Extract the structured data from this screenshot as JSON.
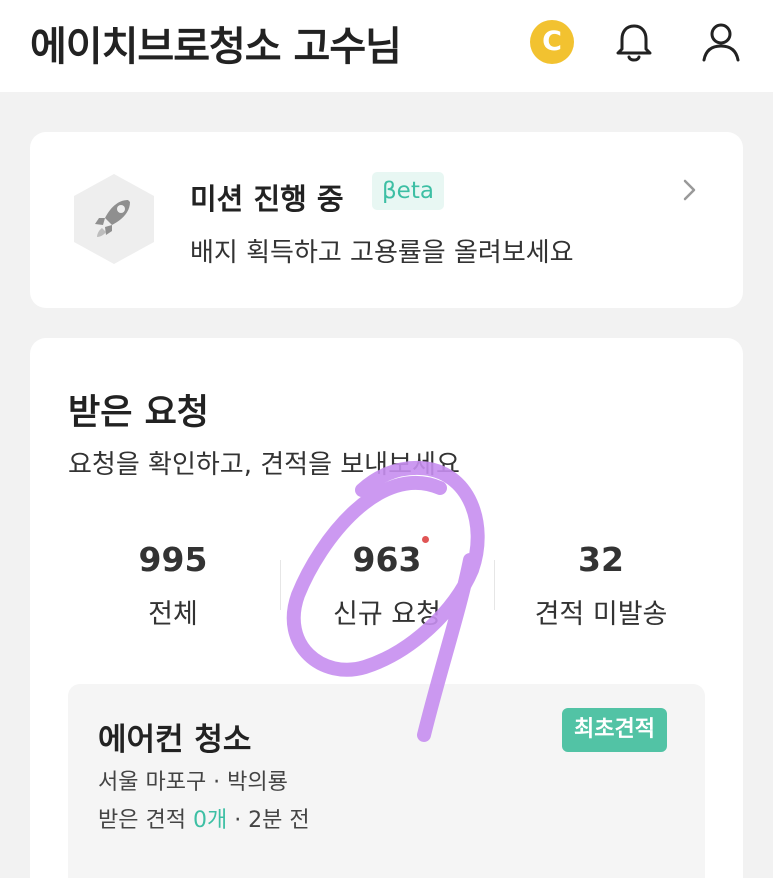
{
  "header": {
    "title": "에이치브로청소 고수님",
    "coin_label": "C",
    "icons": [
      "coin-icon",
      "bell-icon",
      "user-icon"
    ]
  },
  "mission": {
    "title": "미션 진행 중",
    "beta_label": "βeta",
    "subtitle": "배지 획득하고 고용률을 올려보세요",
    "icon": "rocket-icon"
  },
  "requests": {
    "title": "받은 요청",
    "subtitle": "요청을 확인하고, 견적을 보내보세요",
    "stats": [
      {
        "value": "995",
        "label": "전체"
      },
      {
        "value": "963",
        "label": "신규 요청",
        "has_new_dot": true
      },
      {
        "value": "32",
        "label": "견적 미발송"
      }
    ],
    "items": [
      {
        "title": "에어컨 청소",
        "tag": "최초견적",
        "location": "서울 마포구 · 박의룡",
        "quotes_prefix": "받은 견적 ",
        "quotes_count": "0개",
        "time": " · 2분 전"
      }
    ]
  },
  "colors": {
    "accent": "#3dbfa4",
    "coin": "#f2c230",
    "tag_bg": "#52c3a5",
    "annotation": "#c78ef0",
    "new_dot": "#e05555"
  }
}
